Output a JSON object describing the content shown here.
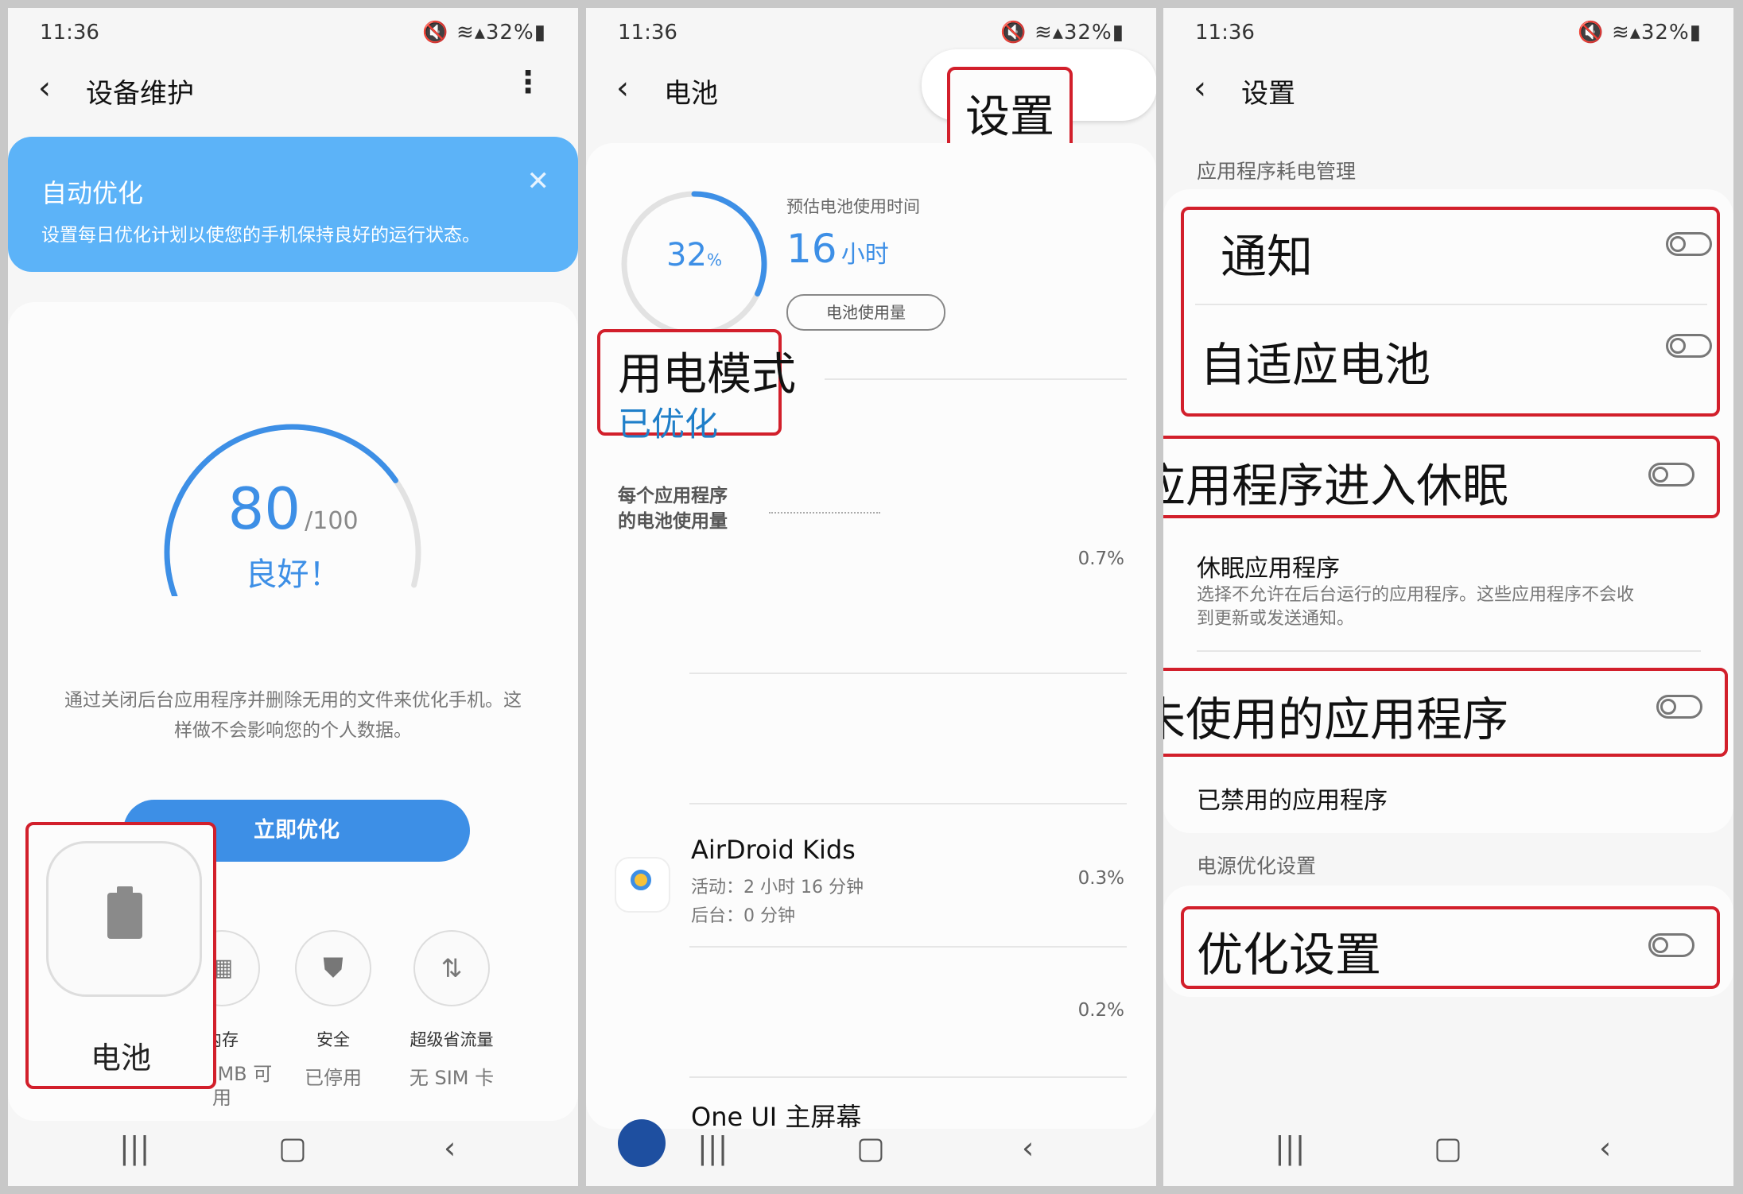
{
  "status": {
    "time": "11:36",
    "battery": "32%"
  },
  "panel1": {
    "header": {
      "title": "设备维护"
    },
    "banner": {
      "title": "自动优化",
      "text": "设置每日优化计划以使您的手机保持良好的运行状态。"
    },
    "score": {
      "value": "80",
      "max": "/100",
      "level": "良好！",
      "fraction": 0.8
    },
    "description_line1": "通过关闭后台应用程序并删除无用的文件来优化手机。这",
    "description_line2": "样做不会影响您的个人数据。",
    "optimize_button": "立即优化",
    "battery": {
      "label": "电池"
    },
    "memory": {
      "label": "内存",
      "value_line1": "794 MB 可",
      "value_line2": "用"
    },
    "security": {
      "label": "安全",
      "value": "已停用"
    },
    "data_saver": {
      "label": "超级省流量",
      "value": "无 SIM 卡"
    }
  },
  "panel2": {
    "header": {
      "title": "电池"
    },
    "settings_callout": "设置",
    "battery_ring": {
      "percent": "32",
      "unit": "%",
      "fraction": 0.32
    },
    "estimate_label": "预估电池使用时间",
    "estimate_value": "16",
    "estimate_unit": "小时",
    "usage_button": "电池使用量",
    "power_mode": {
      "title": "用电模式",
      "value": "已优化"
    },
    "per_app_line1": "每个应用程序",
    "per_app_line2": "的电池使用量",
    "rows": [
      {
        "percent": "0.7%"
      },
      {
        "name": "AirDroid Kids",
        "active": "活动：2 小时 16 分钟",
        "background": "后台：0 分钟",
        "percent": "0.3%"
      },
      {
        "percent": "0.2%"
      },
      {
        "name": "One UI 主屏幕"
      }
    ]
  },
  "panel3": {
    "header": {
      "title": "设置"
    },
    "section1": "应用程序耗电管理",
    "notify": "通知",
    "adaptive": "自适应电池",
    "sleep_unused": "让未使用的应用程序进入休眠",
    "sleeping_apps": {
      "title": "休眠应用程序",
      "desc_line1": "选择不允许在后台运行的应用程序。这些应用程序不会收",
      "desc_line2": "到更新或发送通知。"
    },
    "auto_disable": "自动禁用未使用的应用程序",
    "disabled_apps": "已禁用的应用程序",
    "section2": "电源优化设置",
    "optimize_settings": "优化设置"
  },
  "colors": {
    "accent": "#3d8fe6",
    "banner": "#5cb3f8",
    "red": "#d21f2b"
  }
}
